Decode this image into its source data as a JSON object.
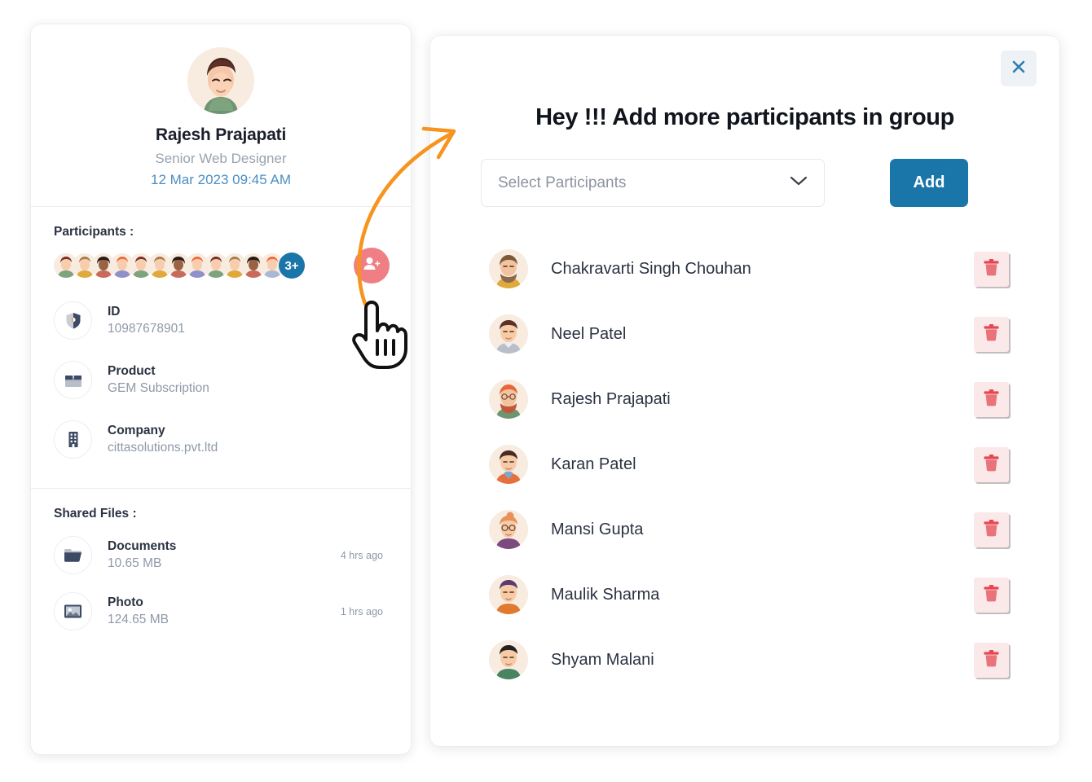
{
  "profile": {
    "avatar_icon": "avatar-rajesh",
    "name": "Rajesh Prajapati",
    "role": "Senior Web Designer",
    "datetime": "12 Mar 2023 09:45 AM",
    "participants_label": "Participants :",
    "participants_overflow_badge": "3+",
    "participants_avatar_count": 12,
    "add_participant_icon": "add-user-icon",
    "details": [
      {
        "icon": "shield-icon",
        "label": "ID",
        "value": "10987678901"
      },
      {
        "icon": "package-icon",
        "label": "Product",
        "value": "GEM Subscription"
      },
      {
        "icon": "building-icon",
        "label": "Company",
        "value": "cittasolutions.pvt.ltd"
      }
    ],
    "shared_files_label": "Shared Files :",
    "files": [
      {
        "icon": "folder-icon",
        "name": "Documents",
        "size": "10.65 MB",
        "time": "4 hrs ago"
      },
      {
        "icon": "image-icon",
        "name": "Photo",
        "size": "124.65 MB",
        "time": "1 hrs ago"
      }
    ]
  },
  "modal": {
    "close_icon": "close-x-icon",
    "title": "Hey !!! Add more participants in group",
    "select_placeholder": "Select Participants",
    "select_chevron_icon": "chevron-down-icon",
    "add_label": "Add",
    "delete_icon": "trash-icon",
    "participants": [
      {
        "name": "Chakravarti Singh Chouhan",
        "avatar": "avatar-beard-yellow"
      },
      {
        "name": "Neel Patel",
        "avatar": "avatar-gray-shirt"
      },
      {
        "name": "Rajesh Prajapati",
        "avatar": "avatar-red-beard-green"
      },
      {
        "name": "Karan Patel",
        "avatar": "avatar-blue-collar"
      },
      {
        "name": "Mansi Gupta",
        "avatar": "avatar-glasses-purple"
      },
      {
        "name": "Maulik Sharma",
        "avatar": "avatar-orange-shirt"
      },
      {
        "name": "Shyam Malani",
        "avatar": "avatar-dark-hair-green"
      }
    ]
  },
  "annotation": {
    "arrow_icon": "curved-arrow-icon",
    "cursor_icon": "pointing-hand-cursor-icon"
  },
  "colors": {
    "accent_blue": "#1a76a8",
    "pink_accent": "#ef7f84",
    "arrow_orange": "#f7941e",
    "delete_bg": "#fbe9ea",
    "delete_icon": "#e8737b",
    "date_blue": "#4b8fc4",
    "muted_text": "#8f99a8"
  }
}
